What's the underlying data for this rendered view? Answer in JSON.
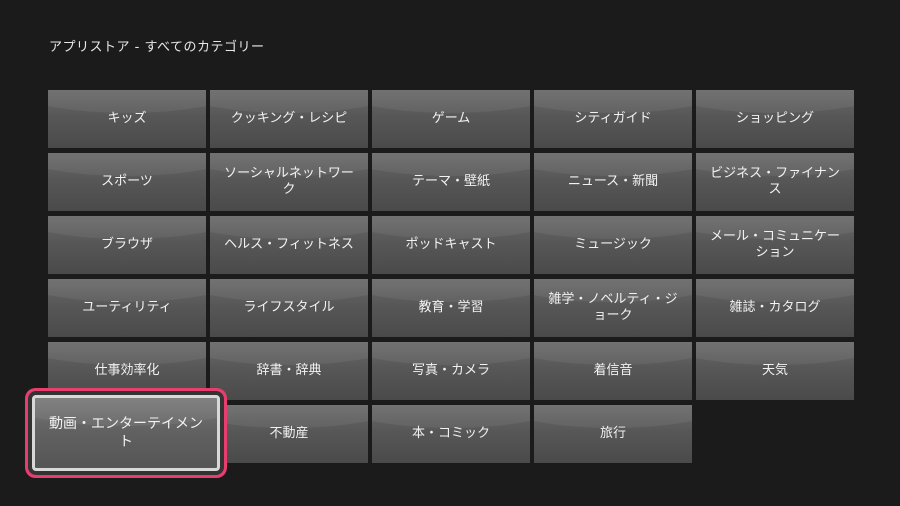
{
  "header": {
    "title": "アプリストア - すべてのカテゴリー"
  },
  "categories": [
    "キッズ",
    "クッキング・レシピ",
    "ゲーム",
    "シティガイド",
    "ショッピング",
    "スポーツ",
    "ソーシャルネットワーク",
    "テーマ・壁紙",
    "ニュース・新聞",
    "ビジネス・ファイナンス",
    "ブラウザ",
    "ヘルス・フィットネス",
    "ポッドキャスト",
    "ミュージック",
    "メール・コミュニケーション",
    "ユーティリティ",
    "ライフスタイル",
    "教育・学習",
    "雑学・ノベルティ・ジョーク",
    "雑誌・カタログ",
    "仕事効率化",
    "辞書・辞典",
    "写真・カメラ",
    "着信音",
    "天気",
    "動画・エンターテイメント",
    "不動産",
    "本・コミック",
    "旅行"
  ],
  "focused_category": "動画・エンターテイメント",
  "colors": {
    "focus_ring": "#e83d6f",
    "tile": "#575757",
    "background": "#1b1b1b"
  }
}
